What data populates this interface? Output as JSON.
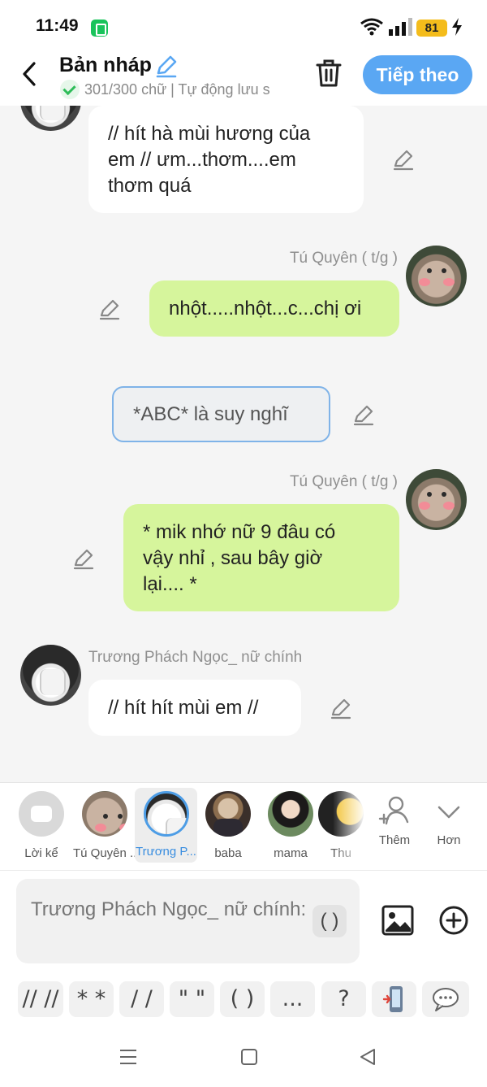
{
  "status": {
    "time": "11:49",
    "battery": "81"
  },
  "header": {
    "title": "Bản nháp",
    "subtitle": "301/300 chữ | Tự động lưu s",
    "next_label": "Tiếp theo"
  },
  "messages": [
    {
      "type": "character",
      "text_lines": [
        "// hít hà mùi hương của",
        "em // ưm...thơm....em",
        "thơm quá"
      ]
    },
    {
      "type": "author",
      "name": "Tú Quyên ( t/g )",
      "text": "nhột.....nhột...c...chị ơi"
    },
    {
      "type": "narration",
      "text": "*ABC* là suy nghĩ"
    },
    {
      "type": "author",
      "name": "Tú Quyên ( t/g )",
      "text_lines": [
        "* mik nhớ nữ 9 đâu có",
        "vậy nhỉ , sau bây giờ",
        "lại.... *"
      ]
    },
    {
      "type": "character",
      "name": "Trương Phách Ngọc_ nữ chính",
      "text": "// hít hít mùi em //"
    }
  ],
  "characters": [
    {
      "label": "Lời kể",
      "icon": "suggestion-bubble-icon"
    },
    {
      "label": "Tú Quyên ...",
      "icon": "cat-avatar"
    },
    {
      "label": "Trương P...",
      "icon": "girl-mask-avatar",
      "active": true
    },
    {
      "label": "baba",
      "icon": "man-avatar"
    },
    {
      "label": "mama",
      "icon": "woman-avatar"
    },
    {
      "label": "Thu",
      "icon": "yellow-avatar"
    }
  ],
  "char_actions": {
    "add_label": "Thêm",
    "more_label": "Hơn"
  },
  "input": {
    "placeholder": "Trương Phách Ngọc_ nữ chính:",
    "paren_chip": "( )"
  },
  "quick_symbols": [
    "// //",
    "* *",
    "/ /",
    "\" \"",
    "( )",
    "...",
    "?"
  ],
  "colors": {
    "accent": "#5aa7f3",
    "author_bubble": "#d6f59c",
    "narration_border": "#7fb3e8"
  }
}
